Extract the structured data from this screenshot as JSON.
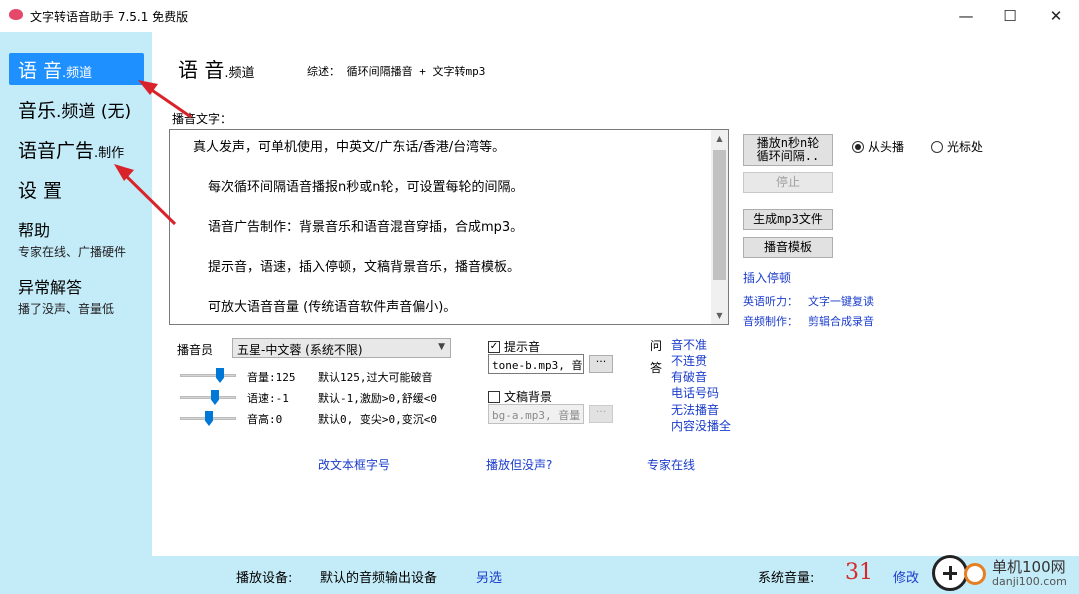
{
  "window": {
    "title": "文字转语音助手 7.5.1 免费版",
    "minimize": "—",
    "maximize": "☐",
    "close": "✕"
  },
  "sidebar": {
    "items": [
      {
        "big": "语 音",
        "small": ".频道",
        "sub": ""
      },
      {
        "big": "音乐",
        "small": ".频道 (无)",
        "sub": ""
      },
      {
        "big": "语音广告",
        "small": ".制作",
        "sub": ""
      },
      {
        "big": "设 置",
        "small": "",
        "sub": ""
      },
      {
        "big": "帮助",
        "small": "",
        "sub": "专家在线、广播硬件"
      },
      {
        "big": "异常解答",
        "small": "",
        "sub": "播了没声、音量低"
      }
    ],
    "active_index": 0
  },
  "main": {
    "title_big": "语 音",
    "title_small": ".频道",
    "summary": "综述： 循环间隔播音 + 文字转mp3",
    "text_label": "播音文字：",
    "text_lines": [
      "真人发声，可单机使用，中英文/广东话/香港/台湾等。",
      "每次循环间隔语音播报n秒或n轮，可设置每轮的间隔。",
      "语音广告制作：背景音乐和语音混音穿插，合成mp3。",
      "提示音，语速，插入停顿，文稿背景音乐，播音模板。",
      "可放大语音音量 (传统语音软件声音偏小)。"
    ]
  },
  "controls": {
    "play_button_line1": "播放n秒n轮",
    "play_button_line2": "循环间隔..",
    "stop_button": "停止",
    "gen_mp3_button": "生成mp3文件",
    "template_button": "播音模板",
    "radio_from_start": "从头播",
    "radio_cursor": "光标处",
    "radio_selected": "from_start",
    "insert_pause": "插入停顿",
    "english_label": "英语听力：",
    "english_link": "文字一键复读",
    "audio_label": "音频制作：",
    "audio_link": "剪辑合成录音"
  },
  "voice": {
    "announcer_label": "播音员",
    "announcer_value": "五星-中文蓉 (系统不限)",
    "volume": {
      "label": "音量:125",
      "hint": "默认125,过大可能破音",
      "level": 0.72
    },
    "speed": {
      "label": "语速:-1",
      "hint": "默认-1,激励>0,舒缓<0",
      "level": 0.62
    },
    "pitch": {
      "label": "音高:0",
      "hint": "默认0, 变尖>0,变沉<0",
      "level": 0.5
    }
  },
  "sound": {
    "prompt_tone_label": "提示音",
    "prompt_tone_checked": true,
    "prompt_tone_file": "tone-b.mp3, 音",
    "bg_label": "文稿背景",
    "bg_checked": false,
    "bg_file": "bg-a.mp3, 音量",
    "browse": "···"
  },
  "faq": {
    "label_q": "问",
    "label_a": "答",
    "links": [
      "音不准",
      "不连贯",
      "有破音",
      "电话号码",
      "无法播音",
      "内容没播全"
    ]
  },
  "bottom_links": {
    "font": "改文本框字号",
    "no_sound": "播放但没声?",
    "expert": "专家在线"
  },
  "statusbar": {
    "device_label": "播放设备:",
    "device_value": "默认的音频输出设备",
    "device_change": "另选",
    "volume_label": "系统音量:",
    "volume_value": "31",
    "volume_change": "修改"
  },
  "watermark": {
    "line1": "单机100网",
    "line2": "danji100.com"
  },
  "colors": {
    "sidebar_bg": "#c4ebf8",
    "active_item": "#1e90ff",
    "link": "#1a3ccc",
    "arrow": "#d9232b"
  }
}
